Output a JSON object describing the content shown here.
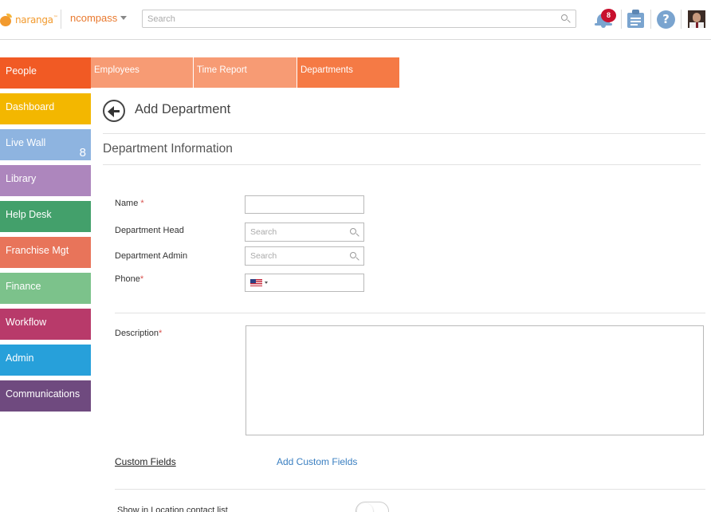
{
  "header": {
    "logo_text": "naranga",
    "logo_mark": "™",
    "brand": "ncompass",
    "search_placeholder": "Search",
    "notifications_count": "8",
    "help_label": "?",
    "icons": [
      "orange-logo-icon",
      "chevron-down-icon",
      "search-icon",
      "bell-icon",
      "clipboard-icon",
      "help-icon",
      "avatar"
    ]
  },
  "sidebar": {
    "items": [
      {
        "label": "People",
        "color": "#f15a24",
        "count": ""
      },
      {
        "label": "Dashboard",
        "color": "#f3b700",
        "count": ""
      },
      {
        "label": "Live Wall",
        "color": "#8eb4e0",
        "count": "8"
      },
      {
        "label": "Library",
        "color": "#ad86bd",
        "count": ""
      },
      {
        "label": "Help Desk",
        "color": "#43a06b",
        "count": ""
      },
      {
        "label": "Franchise Mgt",
        "color": "#e8745a",
        "count": ""
      },
      {
        "label": "Finance",
        "color": "#7cc28b",
        "count": ""
      },
      {
        "label": "Workflow",
        "color": "#b83a6a",
        "count": ""
      },
      {
        "label": "Admin",
        "color": "#27a0da",
        "count": ""
      },
      {
        "label": "Communications",
        "color": "#6f4a7f",
        "count": ""
      }
    ]
  },
  "tabs": [
    {
      "label": "Employees",
      "color": "#f79b74",
      "active": false
    },
    {
      "label": "Time Report",
      "color": "#f79b74",
      "active": false
    },
    {
      "label": "Departments",
      "color": "#f57a45",
      "active": true
    }
  ],
  "page": {
    "title": "Add Department",
    "section_title": "Department Information"
  },
  "form": {
    "name_label": "Name",
    "name_value": "",
    "department_head_label": "Department Head",
    "department_head_placeholder": "Search",
    "department_admin_label": "Department Admin",
    "department_admin_placeholder": "Search",
    "phone_label": "Phone",
    "phone_value": "",
    "phone_country": "us-flag-icon",
    "description_label": "Description",
    "description_value": "",
    "required_mark": "*",
    "custom_fields_label": "Custom Fields",
    "add_custom_fields_label": "Add Custom Fields",
    "show_in_contact_list_label": "Show in Location contact list",
    "show_in_contact_list_on": false
  }
}
